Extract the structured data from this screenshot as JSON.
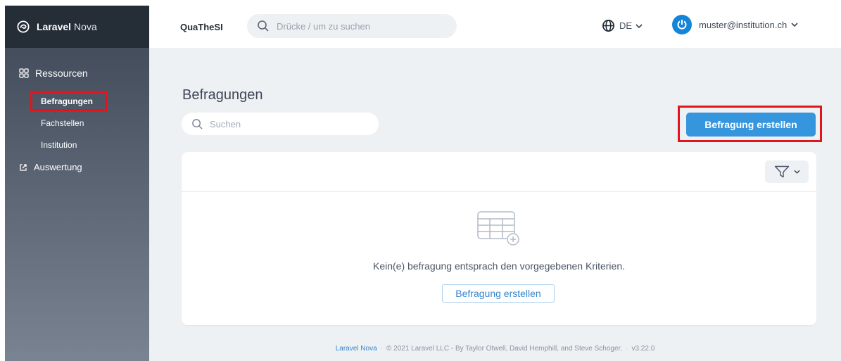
{
  "sidebar": {
    "brand_bold": "Laravel",
    "brand_rest": "Nova",
    "group_resources": "Ressourcen",
    "items": [
      {
        "label": "Befragungen",
        "active": true
      },
      {
        "label": "Fachstellen"
      },
      {
        "label": "Institution"
      }
    ],
    "group_external": "Auswertung"
  },
  "header": {
    "app_name": "QuaTheSI",
    "search_placeholder": "Drücke / um zu suchen",
    "language": "DE",
    "user_email": "muster@institution.ch"
  },
  "main": {
    "title": "Befragungen",
    "search_placeholder": "Suchen",
    "create_label": "Befragung erstellen",
    "empty_message": "Kein(e) befragung entsprach den vorgegebenen Kriterien.",
    "empty_create_label": "Befragung erstellen"
  },
  "footer": {
    "link": "Laravel Nova",
    "copyright": "© 2021 Laravel LLC - By Taylor Otwell, David Hemphill, and Steve Schoger.",
    "version": "v3.22.0"
  },
  "colors": {
    "accent": "#3596dd",
    "highlight": "#e3141c",
    "sidebar_top": "#252d37"
  }
}
